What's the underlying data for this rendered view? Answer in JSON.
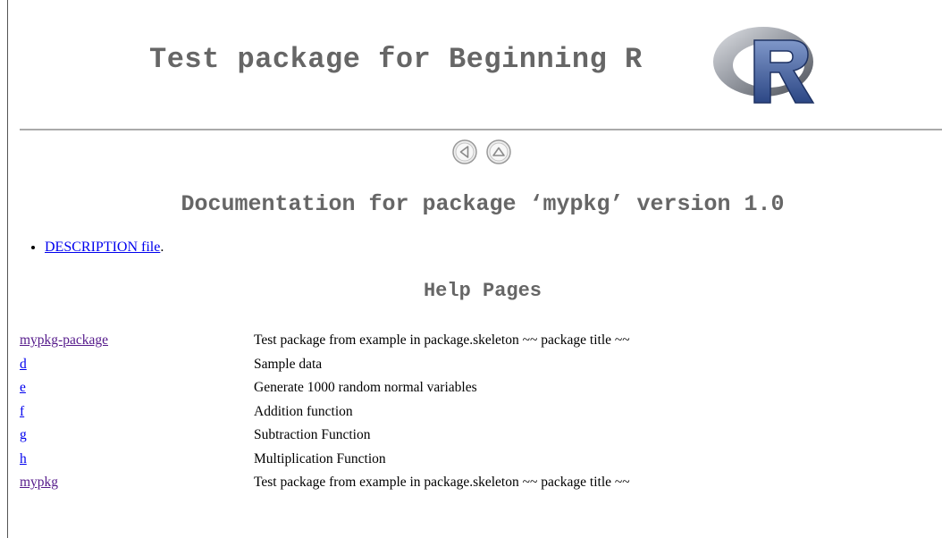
{
  "header": {
    "title": "Test package for Beginning R",
    "logo": "r-logo"
  },
  "nav": {
    "icons": [
      "back-arrow-icon",
      "up-arrow-icon"
    ]
  },
  "doc_title": "Documentation for package ‘mypkg’ version 1.0",
  "description": {
    "link_label": "DESCRIPTION file",
    "suffix": "."
  },
  "help_title": "Help Pages",
  "help_pages": [
    {
      "name": "mypkg-package",
      "description": "Test package from example in package.skeleton ~~ package title ~~",
      "visited": true
    },
    {
      "name": "d",
      "description": "Sample data",
      "visited": false
    },
    {
      "name": "e",
      "description": "Generate 1000 random normal variables",
      "visited": false
    },
    {
      "name": "f",
      "description": "Addition function",
      "visited": false
    },
    {
      "name": "g",
      "description": "Subtraction Function",
      "visited": false
    },
    {
      "name": "h",
      "description": "Multiplication Function",
      "visited": false
    },
    {
      "name": "mypkg",
      "description": "Test package from example in package.skeleton ~~ package title ~~",
      "visited": true
    }
  ],
  "colors": {
    "heading": "#666666",
    "link": "#0000ee",
    "visited_link": "#551a8b",
    "rule": "#aaaaaa"
  }
}
